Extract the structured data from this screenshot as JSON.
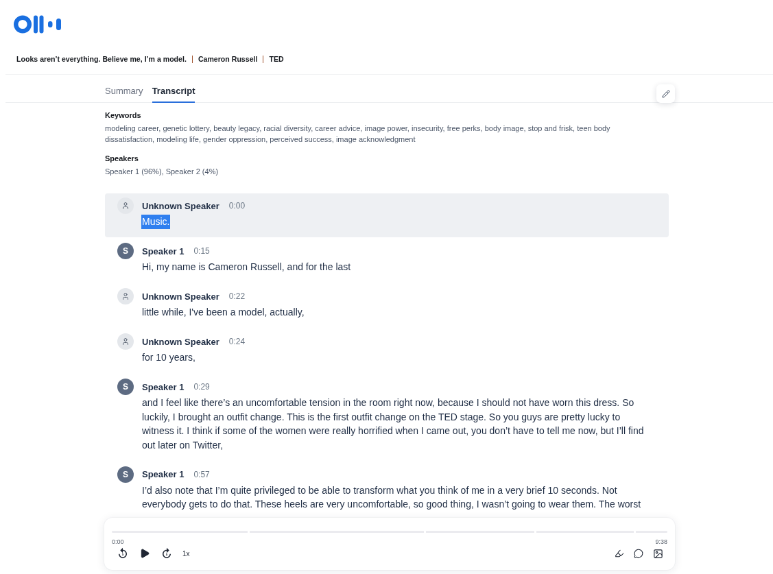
{
  "header": {
    "title": "Looks aren’t everything. Believe me, I’m a model.",
    "speaker": "Cameron Russell",
    "source": "TED"
  },
  "tabs": [
    {
      "label": "Summary",
      "selected": false
    },
    {
      "label": "Transcript",
      "selected": true
    }
  ],
  "keywords": {
    "heading": "Keywords",
    "text": "modeling career, genetic lottery, beauty legacy, racial diversity, career advice, image power, insecurity, free perks, body image, stop and frisk, teen body dissatisfaction, modeling life, gender oppression, perceived success, image acknowledgment"
  },
  "speakers": {
    "heading": "Speakers",
    "text": "Speaker 1 (96%), Speaker 2 (4%)"
  },
  "transcript": [
    {
      "speaker": "Unknown Speaker",
      "time": "0:00",
      "avatar": {
        "kind": "unknown"
      },
      "text": "Music.",
      "selected": true,
      "highlighted": true
    },
    {
      "speaker": "Speaker 1",
      "time": "0:15",
      "avatar": {
        "kind": "initial",
        "initial": "S"
      },
      "text": "Hi, my name is Cameron Russell, and for the last",
      "selected": false,
      "highlighted": false
    },
    {
      "speaker": "Unknown Speaker",
      "time": "0:22",
      "avatar": {
        "kind": "unknown"
      },
      "text": "little while, I've been a model, actually,",
      "selected": false,
      "highlighted": false
    },
    {
      "speaker": "Unknown Speaker",
      "time": "0:24",
      "avatar": {
        "kind": "unknown"
      },
      "text": "for 10 years,",
      "selected": false,
      "highlighted": false
    },
    {
      "speaker": "Speaker 1",
      "time": "0:29",
      "avatar": {
        "kind": "initial",
        "initial": "S"
      },
      "text": "and I feel like there’s an uncomfortable tension in the room right now, because I should not have worn this dress. So luckily, I brought an outfit change. This is the first outfit change on the TED stage. So you guys are pretty lucky to witness it. I think if some of the women were really horrified when I came out, you don’t have to tell me now, but I’ll find out later on Twitter,",
      "selected": false,
      "highlighted": false
    },
    {
      "speaker": "Speaker 1",
      "time": "0:57",
      "avatar": {
        "kind": "initial",
        "initial": "S"
      },
      "text": "I’d also note that I’m quite privileged to be able to transform what you think of me in a very brief 10 seconds. Not everybody gets to do that. These heels are very uncomfortable, so good thing, I wasn’t going to wear them. The worst",
      "selected": false,
      "highlighted": false
    }
  ],
  "player": {
    "elapsed": "0:00",
    "duration": "9:38",
    "speed": "1x",
    "playing": false
  }
}
